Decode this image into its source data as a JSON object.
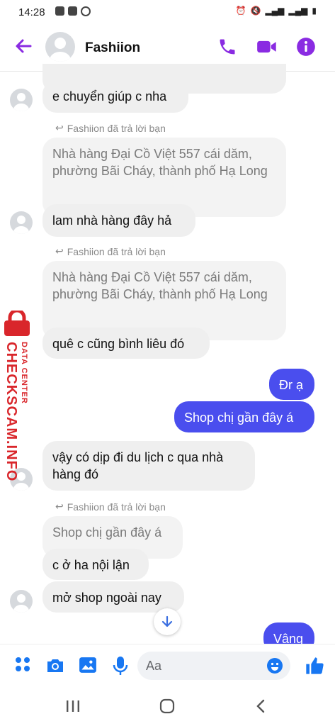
{
  "status": {
    "time": "14:28"
  },
  "header": {
    "name": "Fashiion"
  },
  "messages": {
    "m1": "e chuyển giúp c nha",
    "reply_note_1": "Fashiion đã trả lời bạn",
    "quoted_1": "Nhà hàng Đại Cồ Việt  557 cái dăm, phường Bãi Cháy, thành phố Hạ Long",
    "m2": "lam nhà hàng đây hả",
    "reply_note_2": "Fashiion đã trả lời bạn",
    "quoted_2": "Nhà hàng Đại Cồ Việt  557 cái dăm, phường Bãi Cháy, thành phố Hạ Long",
    "m3": "quê c cũng bình liêu đó",
    "me1": "Đr ạ",
    "me2": "Shop chị gần đây á",
    "m4": "vậy có dịp đi du lịch c qua nhà hàng đó",
    "reply_note_3": "Fashiion đã trả lời bạn",
    "quoted_3": "Shop chị gần đây á",
    "m5": "c ở ha nội lận",
    "m6": "mở shop ngoài nay",
    "me3": "Vâng"
  },
  "watermark": {
    "line1": "DATA CENTER",
    "line2": "CHECKSCAM.INFO"
  },
  "composer": {
    "placeholder": "Aa"
  },
  "colors": {
    "accent": "#8a2be2",
    "my_bubble": "#4a4eee",
    "watermark": "#d9262b"
  }
}
